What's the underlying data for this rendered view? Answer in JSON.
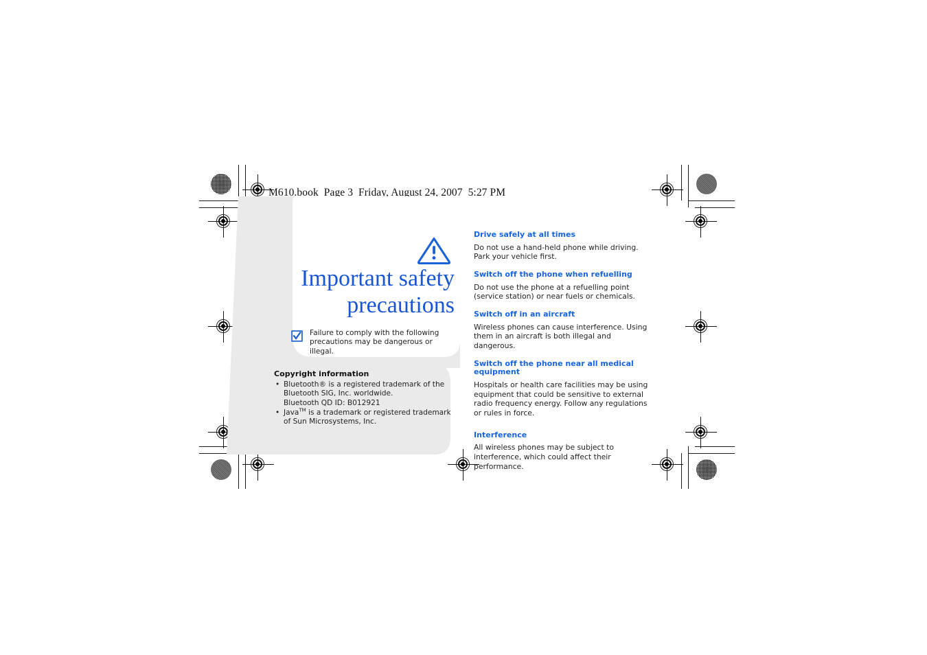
{
  "file_header": "M610.book  Page 3  Friday, August 24, 2007  5:27 PM",
  "colors": {
    "heading_blue": "#1764e0",
    "title_blue": "#1856d6",
    "panel_gray": "#eaeaea",
    "body_text": "#231f20"
  },
  "cover": {
    "title_line1": "Important safety",
    "title_line2": "precautions",
    "warning_icon": "warning-triangle-icon",
    "checkbox_icon": "checkbox-checked-icon",
    "notice": "Failure to comply with the following precautions may be dangerous or illegal."
  },
  "copyright": {
    "heading": "Copyright information",
    "bullet_glyph": "•",
    "items": [
      {
        "lines": [
          "Bluetooth® is a registered trademark of the",
          "Bluetooth SIG, Inc. worldwide.",
          "Bluetooth QD ID: B012921"
        ]
      },
      {
        "prefix": "Java",
        "tm": "TM",
        "suffix": " is a trademark or registered trademark of Sun Microsystems, Inc."
      }
    ]
  },
  "sections": [
    {
      "heading": "Drive safely at all times",
      "body": "Do not use a hand-held phone while driving. Park your vehicle first."
    },
    {
      "heading": "Switch off the phone when refuelling",
      "body": "Do not use the phone at a refuelling point (service station) or near fuels or chemicals."
    },
    {
      "heading": "Switch off in an aircraft",
      "body": "Wireless phones can cause interference. Using them in an aircraft is both illegal and dangerous."
    },
    {
      "heading": "Switch off the phone near all medical equipment",
      "body": "Hospitals or health care facilities may be using equipment that could be sensitive to external radio frequency energy. Follow any regulations or rules in force."
    },
    {
      "heading": "Interference",
      "body": "All wireless phones may be subject to interference, which could affect their performance."
    }
  ]
}
